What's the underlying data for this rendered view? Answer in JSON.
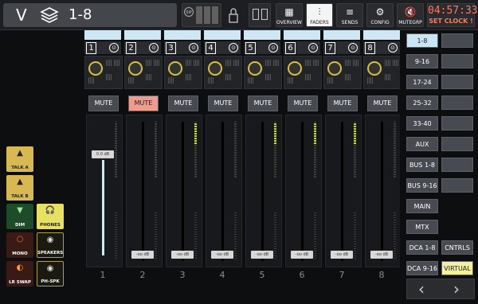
{
  "topbar": {
    "layer_letter": "V",
    "bank_label": "1-8",
    "solo_label": "SIP",
    "buttons": [
      {
        "name": "overview",
        "label": "OVERVIEW"
      },
      {
        "name": "faders",
        "label": "FADERS"
      },
      {
        "name": "sends",
        "label": "SENDS"
      },
      {
        "name": "config",
        "label": "CONFIG"
      },
      {
        "name": "mutegrp",
        "label": "MUTEGRP"
      }
    ],
    "clock_time": "04:57:33",
    "clock_set": "SET CLOCK !"
  },
  "left_panel": {
    "talk_a": "TALK A",
    "talk_b": "TALK B",
    "dim": "DIM",
    "mono": "MONO",
    "lr_swap": "LR SWAP",
    "phones": "PHONES",
    "speakers": "SPEAKERS",
    "ph_spk": "PH-SPK"
  },
  "strips": [
    {
      "number": "1",
      "mute": "MUTE",
      "fader": "0.0 dB",
      "label": "1"
    },
    {
      "number": "2",
      "mute": "MUTE",
      "fader": "-oo dB",
      "label": "2"
    },
    {
      "number": "3",
      "mute": "MUTE",
      "fader": "-oo dB",
      "label": "3"
    },
    {
      "number": "4",
      "mute": "MUTE",
      "fader": "-oo dB",
      "label": "4"
    },
    {
      "number": "5",
      "mute": "MUTE",
      "fader": "-oo dB",
      "label": "5"
    },
    {
      "number": "6",
      "mute": "MUTE",
      "fader": "-oo dB",
      "label": "6"
    },
    {
      "number": "7",
      "mute": "MUTE",
      "fader": "-oo dB",
      "label": "7"
    },
    {
      "number": "8",
      "mute": "MUTE",
      "fader": "-oo dB",
      "label": "8"
    }
  ],
  "right_panel": {
    "banks": [
      "1-8",
      "9-16",
      "17-24",
      "25-32",
      "33-40",
      "AUX",
      "BUS 1-8",
      "BUS 9-16",
      "MAIN",
      "MTX",
      "DCA 1-8",
      "DCA 9-16"
    ],
    "cntrls": "CNTRLS",
    "virtual": "VIRTUAL",
    "prev": "‹",
    "next": "›"
  }
}
